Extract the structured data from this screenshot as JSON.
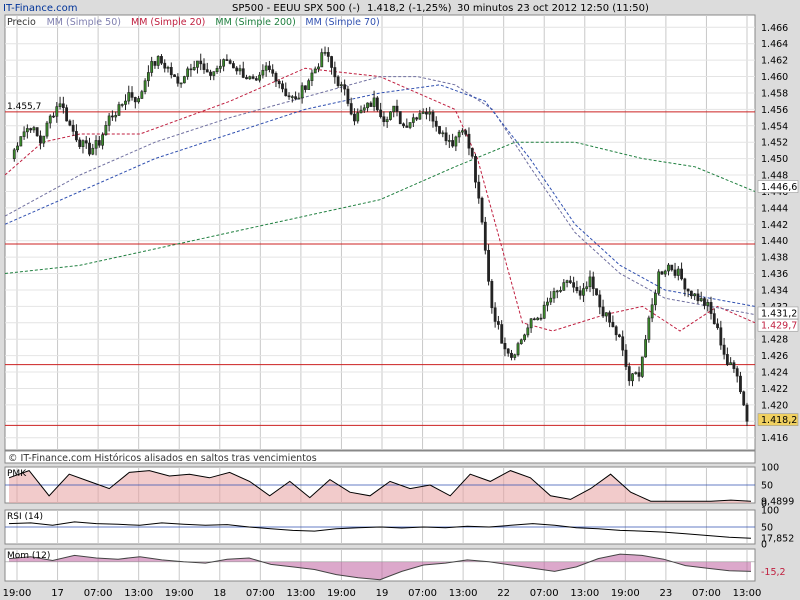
{
  "brand": "IT-Finance.com",
  "header": {
    "symbol": "SP500 - EEUU SPX 500 (-)",
    "quote": "1.418,2 (-1,25%)",
    "interval": "30 minutos",
    "datetime": "23 oct 2012 12:50 (11:50)"
  },
  "legend": [
    {
      "label": "Precio",
      "color": "#333333"
    },
    {
      "label": "MM (Simple 50)",
      "color": "#8080b0"
    },
    {
      "label": "MM (Simple 20)",
      "color": "#c02040"
    },
    {
      "label": "MM (Simple 200)",
      "color": "#208040"
    },
    {
      "label": "MM (Simple 70)",
      "color": "#3050b0"
    }
  ],
  "footer_note": "© IT-Finance.com  Históricos alisados en saltos tras vencimientos",
  "colors": {
    "up": "#3a8a2a",
    "down": "#222222",
    "level": "#cc2020",
    "bg": "#ffffff",
    "grid": "#c8c8c8",
    "price_tag": "#f0d060"
  },
  "chart_data": [
    {
      "type": "candlestick",
      "title": "SP500 - EEUU SPX 500 (-)",
      "ylim": [
        1.4145,
        1.4675
      ],
      "y_ticks": [
        "1.466",
        "1.464",
        "1.462",
        "1.460",
        "1.458",
        "1.456",
        "1.454",
        "1.452",
        "1.450",
        "1.448",
        "1.446",
        "1.444",
        "1.442",
        "1.440",
        "1.438",
        "1.436",
        "1.434",
        "1.432",
        "1.430",
        "1.428",
        "1.426",
        "1.424",
        "1.422",
        "1.420",
        "1.418",
        "1.416"
      ],
      "x_ticks": [
        "19:00",
        "17",
        "07:00",
        "13:00",
        "19:00",
        "18",
        "07:00",
        "13:00",
        "19:00",
        "19",
        "07:00",
        "13:00",
        "22",
        "07:00",
        "13:00",
        "19:00",
        "23",
        "07:00",
        "13:00"
      ],
      "horizontal_levels": [
        1.4557,
        1.4396,
        1.4249,
        1.4175
      ],
      "price_labels": [
        {
          "text": "1.455,7",
          "value": 1.4557
        },
        {
          "text": "1.446,6",
          "value": 1.4466,
          "bg": "#ffffff"
        },
        {
          "text": "1.431,2",
          "value": 1.4312,
          "bg": "#ffffff"
        },
        {
          "text": "1.429,7",
          "value": 1.4297,
          "bg": "#ffffff",
          "fg": "#c02040"
        },
        {
          "text": "1.418,2",
          "value": 1.4182,
          "bg": "#f0d060"
        }
      ],
      "path": [
        1.45,
        1.453,
        1.454,
        1.452,
        1.455,
        1.457,
        1.454,
        1.452,
        1.451,
        1.452,
        1.455,
        1.456,
        1.458,
        1.457,
        1.461,
        1.462,
        1.461,
        1.459,
        1.461,
        1.462,
        1.46,
        1.461,
        1.462,
        1.461,
        1.46,
        1.459,
        1.461,
        1.46,
        1.458,
        1.457,
        1.459,
        1.461,
        1.463,
        1.46,
        1.458,
        1.455,
        1.456,
        1.457,
        1.455,
        1.456,
        1.454,
        1.455,
        1.456,
        1.455,
        1.453,
        1.452,
        1.454,
        1.45,
        1.442,
        1.432,
        1.428,
        1.426,
        1.428,
        1.43,
        1.431,
        1.433,
        1.434,
        1.435,
        1.433,
        1.435,
        1.432,
        1.43,
        1.428,
        1.423,
        1.424,
        1.43,
        1.436,
        1.437,
        1.436,
        1.434,
        1.433,
        1.432,
        1.429,
        1.425,
        1.424,
        1.418
      ],
      "series": [
        {
          "name": "MM (Simple 20)",
          "color": "#c02040",
          "x": [
            0,
            0.05,
            0.1,
            0.18,
            0.3,
            0.4,
            0.5,
            0.55,
            0.6,
            0.63,
            0.66,
            0.69,
            0.73,
            0.8,
            0.85,
            0.9,
            0.95,
            1
          ],
          "values": [
            1.448,
            1.452,
            1.453,
            1.453,
            1.457,
            1.461,
            1.46,
            1.458,
            1.456,
            1.45,
            1.44,
            1.43,
            1.429,
            1.431,
            1.432,
            1.429,
            1.432,
            1.43
          ]
        },
        {
          "name": "MM (Simple 50)",
          "color": "#7070a0",
          "x": [
            0,
            0.1,
            0.2,
            0.3,
            0.42,
            0.5,
            0.55,
            0.6,
            0.65,
            0.7,
            0.76,
            0.82,
            0.88,
            0.94,
            1
          ],
          "values": [
            1.443,
            1.448,
            1.452,
            1.455,
            1.458,
            1.46,
            1.46,
            1.459,
            1.456,
            1.449,
            1.441,
            1.436,
            1.433,
            1.432,
            1.431
          ]
        },
        {
          "name": "MM (Simple 200)",
          "color": "#208040",
          "x": [
            0,
            0.1,
            0.2,
            0.3,
            0.4,
            0.5,
            0.6,
            0.68,
            0.76,
            0.85,
            0.92,
            1
          ],
          "values": [
            1.436,
            1.437,
            1.439,
            1.441,
            1.443,
            1.445,
            1.449,
            1.452,
            1.452,
            1.45,
            1.449,
            1.446
          ]
        },
        {
          "name": "MM (Simple 70)",
          "color": "#3050b0",
          "x": [
            0,
            0.1,
            0.2,
            0.3,
            0.4,
            0.5,
            0.58,
            0.64,
            0.7,
            0.76,
            0.82,
            0.88,
            0.94,
            1
          ],
          "values": [
            1.442,
            1.446,
            1.45,
            1.453,
            1.456,
            1.458,
            1.459,
            1.457,
            1.45,
            1.442,
            1.437,
            1.434,
            1.433,
            1.432
          ]
        }
      ]
    },
    {
      "type": "area",
      "title": "PMK",
      "ylim": [
        0,
        100
      ],
      "y_ticks": [
        "100",
        "50",
        "0"
      ],
      "last_label": "9,4899",
      "values": [
        70,
        90,
        20,
        80,
        60,
        40,
        85,
        90,
        75,
        80,
        70,
        85,
        60,
        20,
        60,
        15,
        65,
        30,
        20,
        60,
        40,
        50,
        20,
        80,
        60,
        90,
        70,
        20,
        10,
        40,
        80,
        30,
        5,
        5,
        5,
        5,
        8,
        5
      ]
    },
    {
      "type": "line",
      "title": "RSI (14)",
      "ylim": [
        0,
        100
      ],
      "y_ticks": [
        "100",
        "50",
        "0"
      ],
      "last_label": "17,852",
      "values": [
        60,
        62,
        55,
        65,
        60,
        58,
        55,
        62,
        58,
        55,
        57,
        50,
        45,
        40,
        38,
        45,
        48,
        50,
        47,
        50,
        48,
        52,
        50,
        55,
        60,
        55,
        48,
        45,
        40,
        38,
        35,
        30,
        25,
        20,
        17
      ]
    },
    {
      "type": "area",
      "title": "Mom (12)",
      "ylim": [
        -30,
        20
      ],
      "last_label": "-15,2",
      "values": [
        5,
        8,
        2,
        10,
        6,
        4,
        8,
        3,
        0,
        -2,
        4,
        6,
        -4,
        -8,
        -12,
        -20,
        -25,
        -28,
        -15,
        -5,
        -2,
        3,
        0,
        -5,
        -10,
        -15,
        -8,
        5,
        12,
        10,
        4,
        -6,
        -10,
        -14,
        -15
      ]
    }
  ]
}
